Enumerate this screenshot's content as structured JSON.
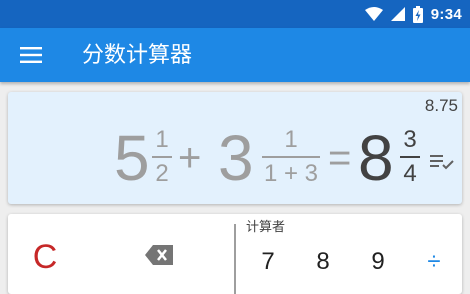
{
  "status_bar": {
    "time": "9:34",
    "icons": [
      "wifi-icon",
      "signal-icon",
      "battery-charging-icon"
    ]
  },
  "app_bar": {
    "title": "分数计算器",
    "menu_icon": "menu-icon"
  },
  "display": {
    "decimal_result": "8.75",
    "expression": {
      "term1_whole": "5",
      "term1_num": "1",
      "term1_den": "2",
      "plus": "+",
      "term2_whole": "3",
      "term2_num": "1",
      "term2_den": "1 + 3",
      "equals": "=",
      "result_whole": "8",
      "result_num": "3",
      "result_den": "4"
    },
    "action_icon": "list-check-icon"
  },
  "keypad": {
    "clear": "C",
    "backspace_icon": "backspace-icon",
    "section_label": "计算者",
    "keys": {
      "seven": "7",
      "eight": "8",
      "nine": "9",
      "divide": "÷"
    }
  },
  "colors": {
    "primary": "#1e88e5",
    "primary_dark": "#1565c0",
    "display_bg": "#e3f1fd",
    "clear_red": "#c62828"
  }
}
